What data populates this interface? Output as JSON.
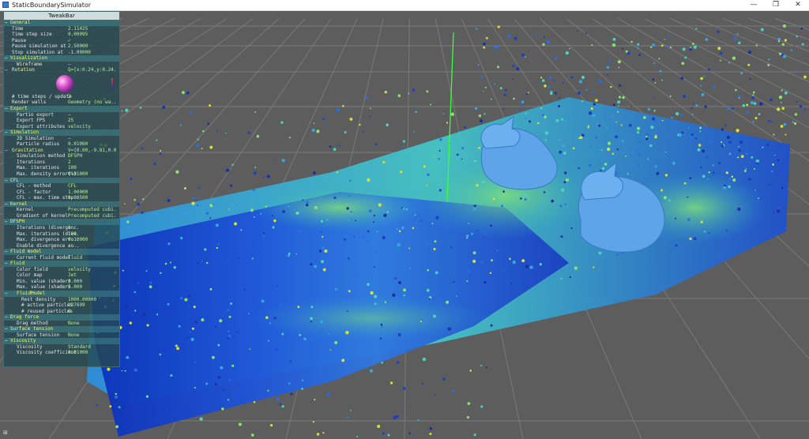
{
  "window": {
    "title": "StaticBoundarySimulator",
    "minimize_glyph": "—",
    "maximize_glyph": "❐",
    "close_glyph": "✕"
  },
  "tweakbar": {
    "title": "TweakBar",
    "rows": [
      {
        "kind": "group",
        "label": "General"
      },
      {
        "kind": "item",
        "indent": 2,
        "label": "Time",
        "value": "2.11425"
      },
      {
        "kind": "item",
        "indent": 2,
        "label": "Time step size",
        "value": "0.00095"
      },
      {
        "kind": "item",
        "indent": 2,
        "label": "Pause",
        "value": "✓"
      },
      {
        "kind": "item",
        "indent": 2,
        "label": "Pause simulation at",
        "value": "2.50000"
      },
      {
        "kind": "item",
        "indent": 2,
        "label": "Stop simulation at",
        "value": "-1.00000"
      },
      {
        "kind": "group",
        "label": "Visualization"
      },
      {
        "kind": "item",
        "indent": 4,
        "label": "Wireframe",
        "value": "–"
      },
      {
        "kind": "sub",
        "label": "Rotation",
        "value": "Q=[x:0.24,y:0.24..."
      },
      {
        "kind": "widget"
      },
      {
        "kind": "item",
        "indent": 2,
        "label": "# time steps / update",
        "value": "2"
      },
      {
        "kind": "item",
        "indent": 2,
        "label": "Render walls",
        "value": "Geometry (no wa..."
      },
      {
        "kind": "group",
        "label": "Export"
      },
      {
        "kind": "item",
        "indent": 4,
        "label": "Partio export",
        "value": "–"
      },
      {
        "kind": "item",
        "indent": 4,
        "label": "Export FPS",
        "value": "25"
      },
      {
        "kind": "item",
        "indent": 4,
        "label": "Export attributes",
        "value": "velocity"
      },
      {
        "kind": "group",
        "label": "Simulation"
      },
      {
        "kind": "item",
        "indent": 4,
        "label": "2D Simulation",
        "value": "–"
      },
      {
        "kind": "item",
        "indent": 4,
        "label": "Particle radius",
        "value": "0.01000"
      },
      {
        "kind": "sub",
        "label": "Gravitation",
        "value": "V={0.00,-9.81,0.0..."
      },
      {
        "kind": "item",
        "indent": 4,
        "label": "Simulation method",
        "value": "DFSPH"
      },
      {
        "kind": "item",
        "indent": 4,
        "label": "Iterations",
        "value": "2"
      },
      {
        "kind": "item",
        "indent": 4,
        "label": "Max. iterations",
        "value": "100"
      },
      {
        "kind": "item",
        "indent": 4,
        "label": "Max. density error(%)",
        "value": "0.01000"
      },
      {
        "kind": "group",
        "label": "CFL"
      },
      {
        "kind": "item",
        "indent": 4,
        "label": "CFL - method",
        "value": "CFL"
      },
      {
        "kind": "item",
        "indent": 4,
        "label": "CFL - factor",
        "value": "1.00000"
      },
      {
        "kind": "item",
        "indent": 4,
        "label": "CFL - max. time step...",
        "value": "0.00500"
      },
      {
        "kind": "group",
        "label": "Kernel"
      },
      {
        "kind": "item",
        "indent": 4,
        "label": "Kernel",
        "value": "Precomputed cubi..."
      },
      {
        "kind": "item",
        "indent": 4,
        "label": "Gradient of kernel",
        "value": "Precomputed cubi..."
      },
      {
        "kind": "group",
        "label": "DFSPH"
      },
      {
        "kind": "item",
        "indent": 4,
        "label": "Iterations (divergenc...",
        "value": "1"
      },
      {
        "kind": "item",
        "indent": 4,
        "label": "Max. iterations (dive...",
        "value": "100"
      },
      {
        "kind": "item",
        "indent": 4,
        "label": "Max. divergence erro...",
        "value": "0.10000"
      },
      {
        "kind": "item",
        "indent": 4,
        "label": "Enable divergence so...",
        "value": "✓"
      },
      {
        "kind": "group",
        "label": "Fluid model"
      },
      {
        "kind": "item",
        "indent": 4,
        "label": "Current fluid model",
        "value": "Fluid"
      },
      {
        "kind": "group",
        "label": "Fluid"
      },
      {
        "kind": "item",
        "indent": 4,
        "label": "Color field",
        "value": "velocity"
      },
      {
        "kind": "item",
        "indent": 4,
        "label": "Color map",
        "value": "Jet"
      },
      {
        "kind": "item",
        "indent": 4,
        "label": "Min. value (shader)",
        "value": "0.000"
      },
      {
        "kind": "item",
        "indent": 4,
        "label": "Max. value (shader)",
        "value": "6.000"
      },
      {
        "kind": "group",
        "label": "FluidModel",
        "indent": 2
      },
      {
        "kind": "item",
        "indent": 6,
        "label": "Rest density",
        "value": "1000.00000"
      },
      {
        "kind": "item",
        "indent": 6,
        "label": "# active particles",
        "value": "237699"
      },
      {
        "kind": "item",
        "indent": 6,
        "label": "# reused particles",
        "value": "0"
      },
      {
        "kind": "group",
        "label": "Drag force"
      },
      {
        "kind": "item",
        "indent": 4,
        "label": "Drag method",
        "value": "None"
      },
      {
        "kind": "group",
        "label": "Surface tension"
      },
      {
        "kind": "item",
        "indent": 4,
        "label": "Surface tension",
        "value": "None"
      },
      {
        "kind": "group",
        "label": "Viscosity"
      },
      {
        "kind": "item",
        "indent": 4,
        "label": "Viscosity",
        "value": "Standard"
      },
      {
        "kind": "item",
        "indent": 4,
        "label": "Viscosity coefficient",
        "value": "0.01000"
      }
    ]
  },
  "scene": {
    "corner_glyph": "⊞",
    "colors": {
      "background": "#5d5d5d",
      "grid": "#7a7a7a",
      "axis_green": "#3cff3c",
      "dragon": "#5fa3e8",
      "panel": "#264950",
      "value_text": "#b4ef9a",
      "group_text": "#f5f56e"
    }
  }
}
